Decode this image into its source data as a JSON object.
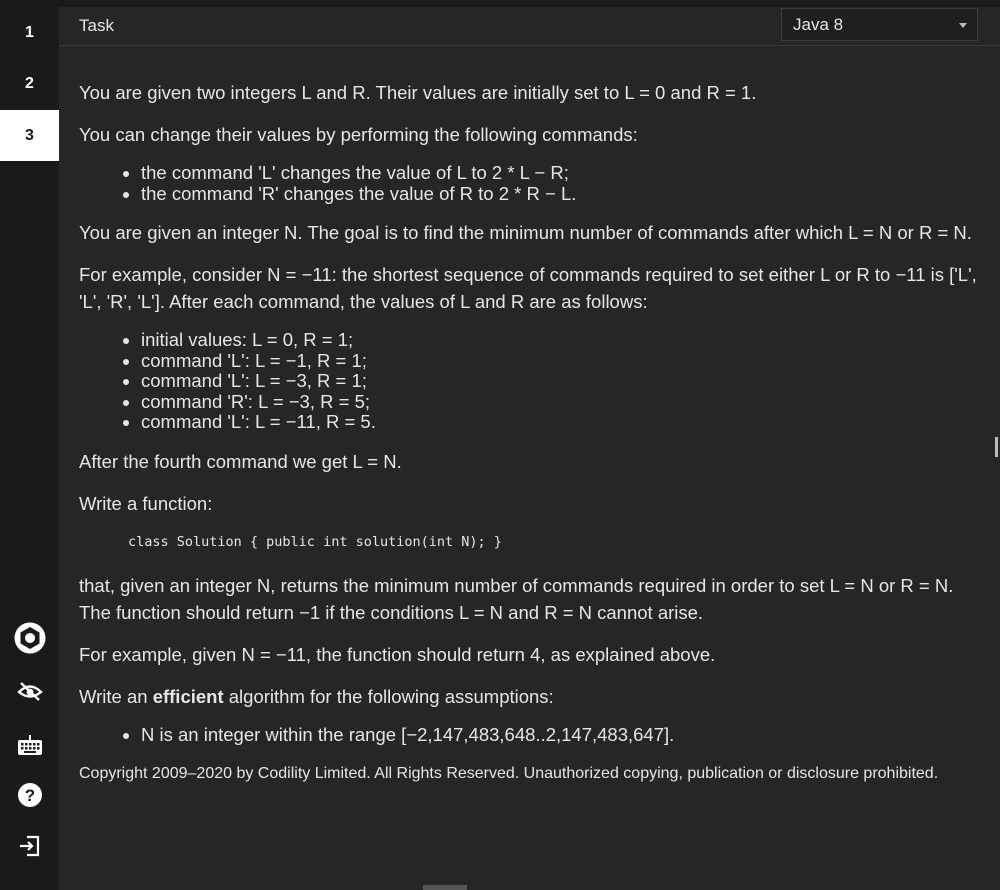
{
  "sidebar": {
    "tasks": [
      {
        "label": "1"
      },
      {
        "label": "2"
      },
      {
        "label": "3"
      }
    ],
    "icons": [
      "settings-icon",
      "hide-icon",
      "keyboard-icon",
      "help-icon",
      "exit-icon"
    ]
  },
  "header": {
    "title": "Task",
    "language": "Java 8"
  },
  "task": {
    "p1": "You are given two integers L and R. Their values are initially set to L = 0 and R = 1.",
    "p2": "You can change their values by performing the following commands:",
    "commands": [
      "the command 'L' changes the value of L to 2 * L − R;",
      "the command 'R' changes the value of R to 2 * R − L."
    ],
    "p3": "You are given an integer N. The goal is to find the minimum number of commands after which L = N or R = N.",
    "p4": "For example, consider N = −11: the shortest sequence of commands required to set either L or R to −11 is ['L', 'L', 'R', 'L']. After each command, the values of L and R are as follows:",
    "steps": [
      "initial values: L = 0, R = 1;",
      "command 'L': L = −1, R = 1;",
      "command 'L': L = −3, R = 1;",
      "command 'R': L = −3, R = 5;",
      "command 'L': L = −11, R = 5."
    ],
    "p5": "After the fourth command we get L = N.",
    "p6": "Write a function:",
    "code": "class Solution { public int solution(int N); }",
    "p7": "that, given an integer N, returns the minimum number of commands required in order to set L = N or R = N. The function should return −1 if the conditions L = N and R = N cannot arise.",
    "p8": "For example, given N = −11, the function should return 4, as explained above.",
    "p9_prefix": "Write an ",
    "p9_bold": "efficient",
    "p9_suffix": " algorithm for the following assumptions:",
    "assumptions": [
      "N is an integer within the range [−2,147,483,648..2,147,483,647]."
    ],
    "copyright": "Copyright 2009–2020 by Codility Limited. All Rights Reserved. Unauthorized copying, publication or disclosure prohibited."
  }
}
